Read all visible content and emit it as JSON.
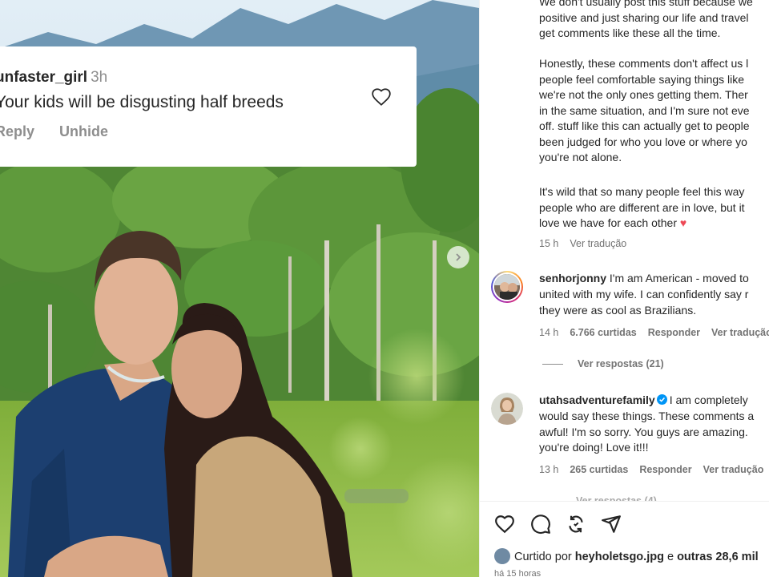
{
  "photo": {
    "comment_card": {
      "username": "unfaster_girl",
      "time": "3h",
      "text": "Your kids will be disgusting half breeds",
      "reply_label": "Reply",
      "unhide_label": "Unhide"
    }
  },
  "caption": {
    "lines_top": [
      "We don't usually post this stuff because we",
      "positive and just sharing our life and travel",
      "get comments like these all the time."
    ],
    "lines_mid": [
      "Honestly, these comments don't affect us l",
      "people feel comfortable saying things like",
      "we're not the only ones getting them. Ther",
      "in the same situation, and I'm sure not eve",
      "off. stuff like this can actually get to people",
      "been judged for who you love or where yo",
      "you're not alone."
    ],
    "lines_end": [
      "It's wild that so many people feel this way",
      "people who are different are in love, but it",
      "love we have for each other"
    ],
    "heart": "♥",
    "time": "15 h",
    "translate": "Ver tradução"
  },
  "comments": [
    {
      "username": "senhorjonny",
      "lines": [
        "I'm am American - moved to",
        "united with my wife. I can confidently say r",
        "they were as cool as Brazilians."
      ],
      "time": "14 h",
      "likes": "6.766 curtidas",
      "reply": "Responder",
      "translate": "Ver tradução"
    },
    {
      "username": "utahsadventurefamily",
      "lines": [
        "I am completely",
        "would say these things. These comments a",
        "awful! I'm so sorry. You guys are amazing.",
        "you're doing! Love it!!!"
      ],
      "time": "13 h",
      "likes": "265 curtidas",
      "reply": "Responder",
      "translate": "Ver tradução"
    }
  ],
  "view_replies": "Ver respostas (21)",
  "ghost_replies": "Ver respostas (4)",
  "actions": {
    "liked_prefix": "Curtido por",
    "liked_user": "heyholetsgo.jpg",
    "liked_and": "e",
    "liked_others": "outras 28,6 mil",
    "timestamp": "há 15 horas"
  },
  "colors": {
    "like_heart": "#ed4956",
    "verified": "#0095f6",
    "muted_text": "#737373"
  }
}
